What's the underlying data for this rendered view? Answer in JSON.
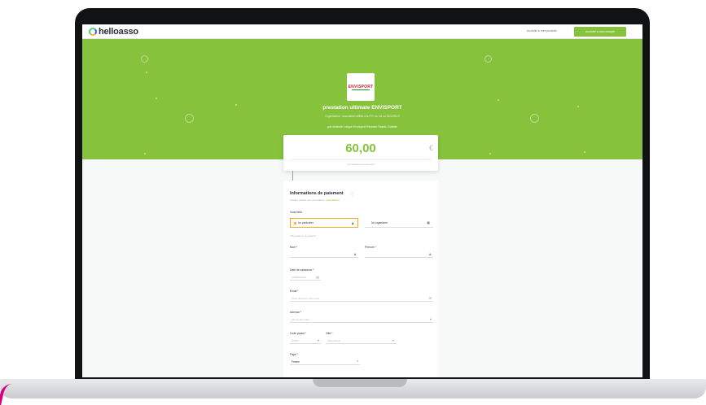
{
  "nav": {
    "logo_text": "helloasso",
    "link": "Accéder à mes produits",
    "cta": "Accéder à mon compte"
  },
  "hero": {
    "org_logo_text": "ENVISPORT",
    "title": "prestation ultimate ENVISPORT",
    "subtitle": "Organisateur : association affiliée à la FFC du 1er au 31/12/2023",
    "org": "par Amicale Laïque Envisport Réunion Sainte-Clotilde",
    "amount_label": "Montant (TTC) à régler :"
  },
  "card": {
    "amount": "60,00",
    "currency": "€",
    "note": "Contribution au paiement"
  },
  "form": {
    "title": "Informations de paiement",
    "help_icon": "question-icon",
    "note_prefix": "Veuillez vérifier vos informations.",
    "note_link": "Tout afficher",
    "vous_etes": "Vous êtes :",
    "option_particulier": "Un particulier",
    "option_organisme": "Un organisme",
    "section_hint": "Informations du payeur",
    "nom_label": "Nom *",
    "prenom_label": "Prénom *",
    "naissance_label": "Date de naissance *",
    "naissance_placeholder": "JJ/MM/AAAA",
    "email_label": "Email *",
    "email_placeholder": "Vous recevrez votre reçu",
    "adresse_label": "Adresse *",
    "adresse_placeholder": "10 rue des Lilas",
    "cp_label": "Code postal *",
    "cp_placeholder": "97400",
    "ville_label": "Ville *",
    "ville_placeholder": "Saint-Denis",
    "pays_label": "Pays *",
    "pays_value": "France"
  },
  "colors": {
    "brand_green": "#86c23c",
    "accent_orange": "#f5a623"
  }
}
